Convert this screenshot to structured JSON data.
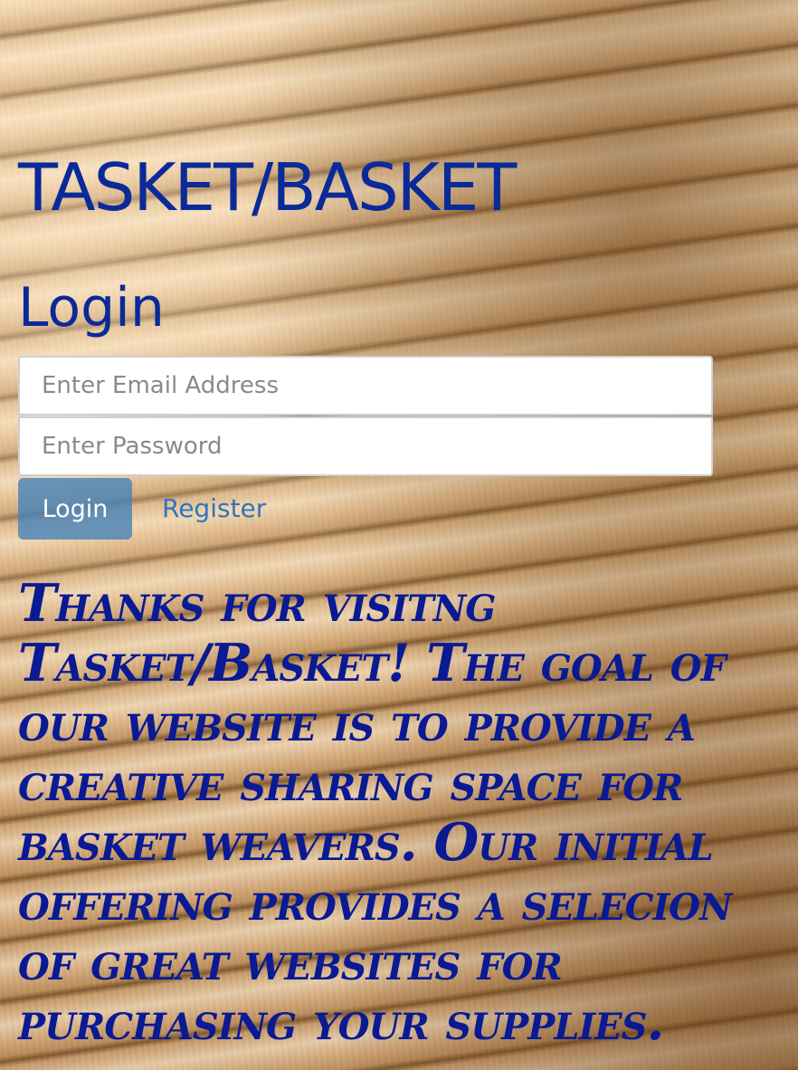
{
  "site": {
    "title": "TASKET/BASKET"
  },
  "login": {
    "heading": "Login",
    "email_placeholder": "Enter Email Address",
    "password_placeholder": "Enter Password",
    "login_label": "Login",
    "register_label": "Register"
  },
  "intro": {
    "text": "Thanks for visitng Tasket/Basket! The goal of our website is to provide a creative sharing space for basket weavers. Our initial offering provides a selecion of great websites for purchasing your supplies."
  },
  "colors": {
    "heading": "#0a2a99",
    "intro_text": "#0a1a93",
    "button_bg": "#4682b9",
    "link": "#2f74c0"
  }
}
